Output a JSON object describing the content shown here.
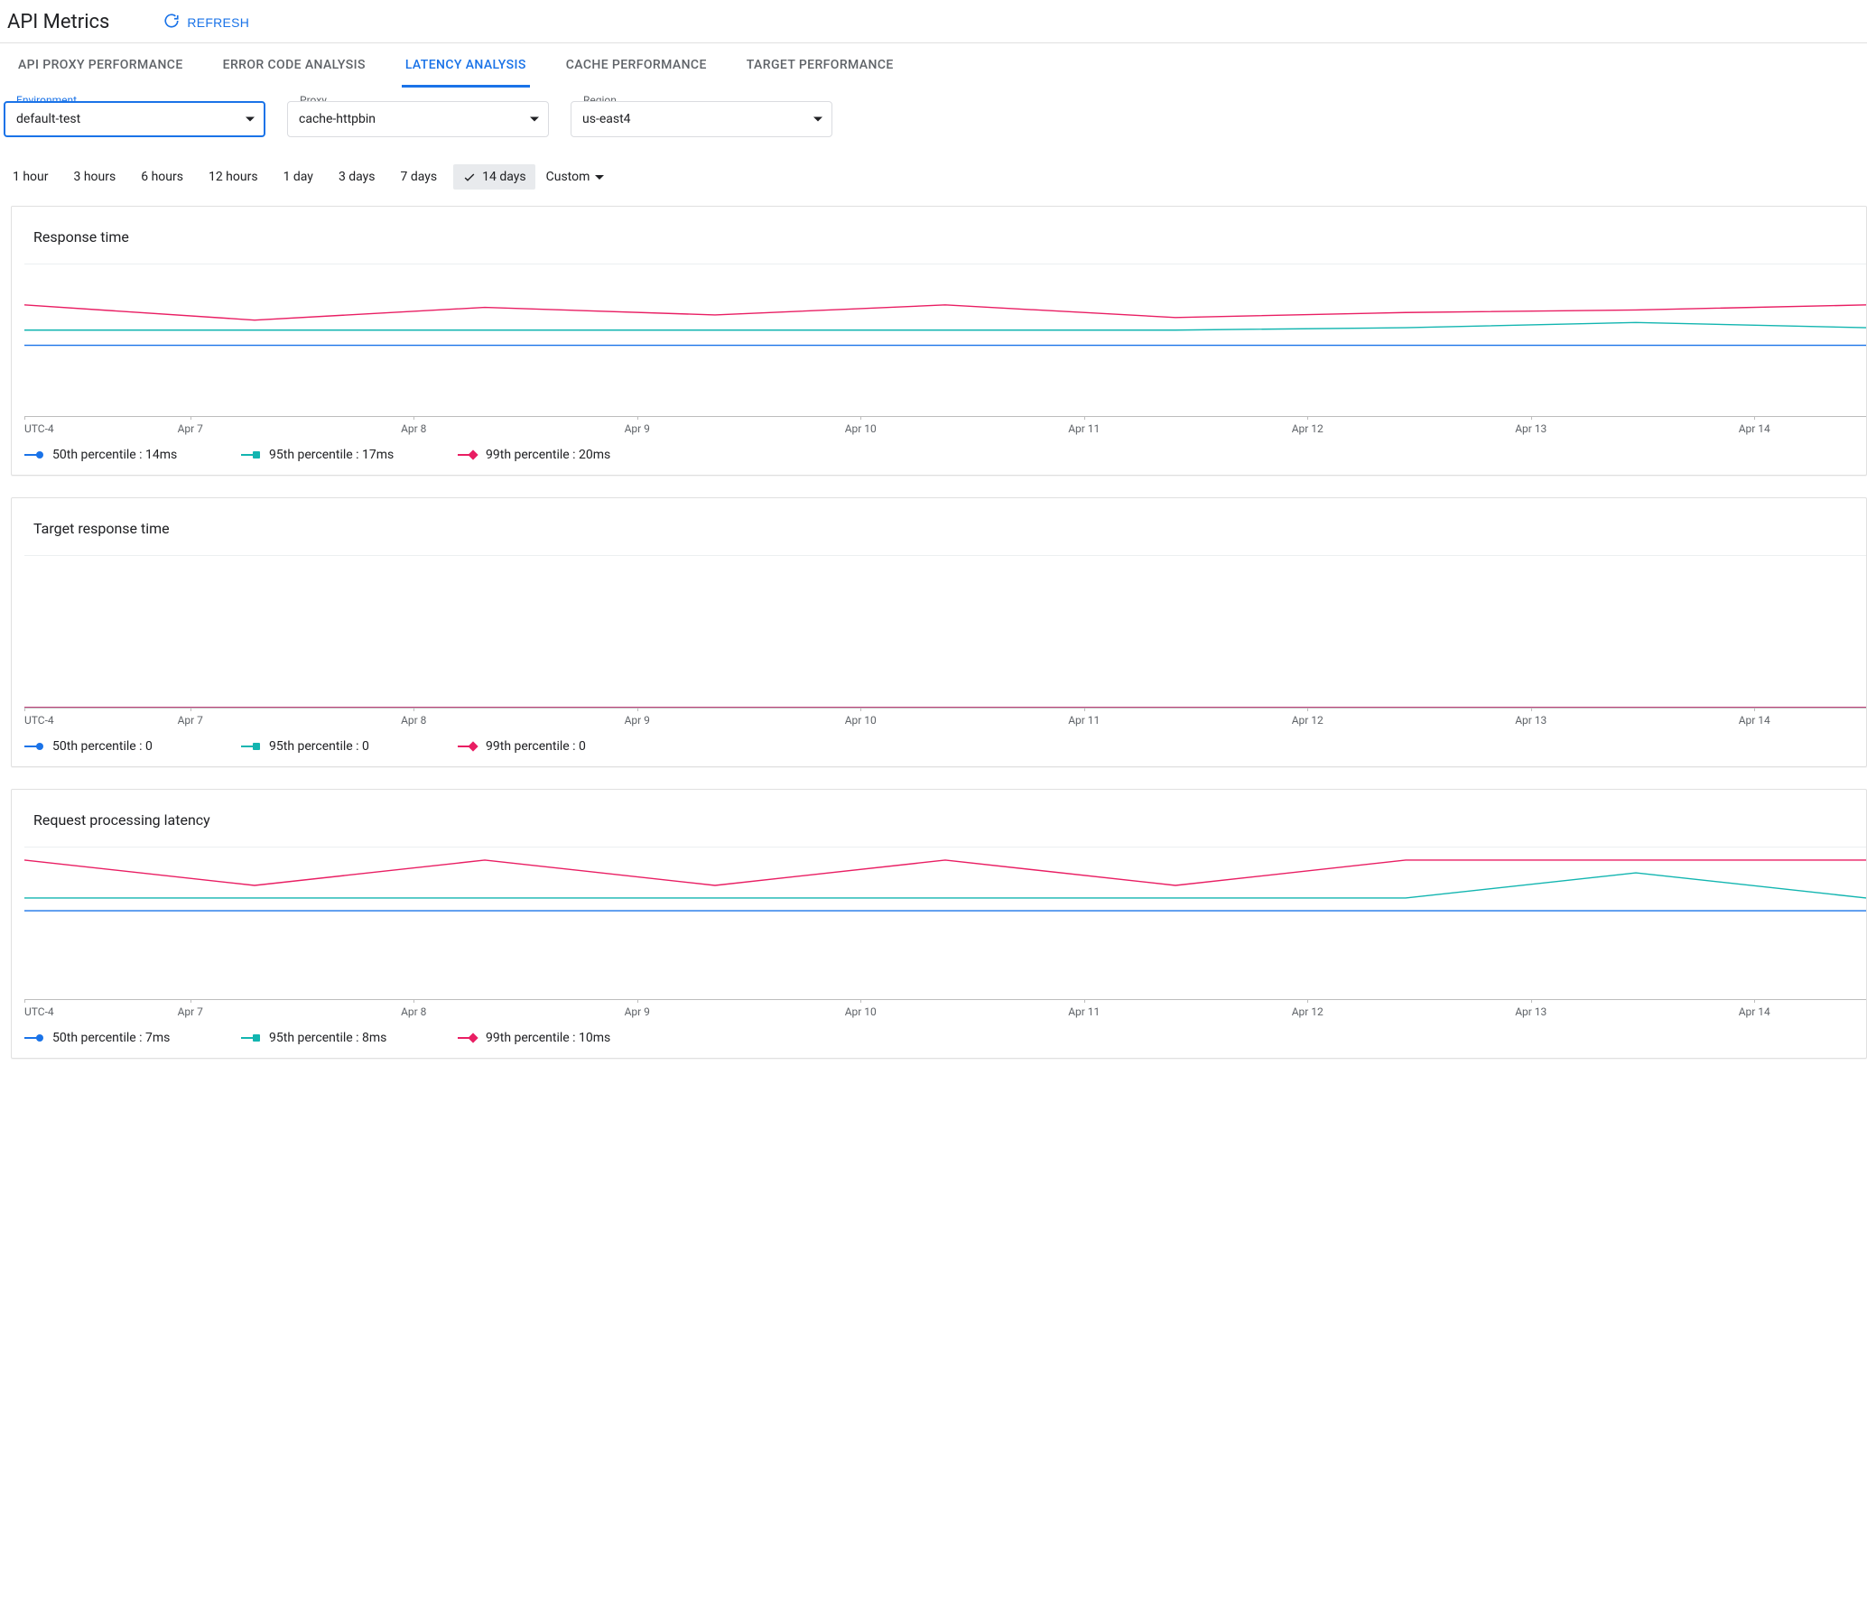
{
  "header": {
    "title": "API Metrics",
    "refresh_label": "REFRESH"
  },
  "tabs": [
    {
      "id": "proxy-perf",
      "label": "API PROXY PERFORMANCE",
      "active": false
    },
    {
      "id": "error-code",
      "label": "ERROR CODE ANALYSIS",
      "active": false
    },
    {
      "id": "latency",
      "label": "LATENCY ANALYSIS",
      "active": true
    },
    {
      "id": "cache",
      "label": "CACHE PERFORMANCE",
      "active": false
    },
    {
      "id": "target",
      "label": "TARGET PERFORMANCE",
      "active": false
    }
  ],
  "selectors": {
    "environment": {
      "label": "Environment",
      "value": "default-test"
    },
    "proxy": {
      "label": "Proxy",
      "value": "cache-httpbin"
    },
    "region": {
      "label": "Region",
      "value": "us-east4"
    }
  },
  "time_range": {
    "options": [
      "1 hour",
      "3 hours",
      "6 hours",
      "12 hours",
      "1 day",
      "3 days",
      "7 days",
      "14 days"
    ],
    "selected": "14 days",
    "custom_label": "Custom"
  },
  "colors": {
    "p50": "#1a73e8",
    "p95": "#12b5b0",
    "p99": "#e91e63"
  },
  "chart_data": [
    {
      "title": "Response time",
      "type": "line",
      "x_tz_label": "UTC-4",
      "categories": [
        "Apr 7",
        "Apr 8",
        "Apr 9",
        "Apr 10",
        "Apr 11",
        "Apr 12",
        "Apr 13",
        "Apr 14"
      ],
      "ylim": [
        0,
        30
      ],
      "series": [
        {
          "name": "50th percentile",
          "legend_value": "14ms",
          "color": "#1a73e8",
          "marker": "circle",
          "values": [
            14,
            14,
            14,
            14,
            14,
            14,
            14,
            14,
            14
          ]
        },
        {
          "name": "95th percentile",
          "legend_value": "17ms",
          "color": "#12b5b0",
          "marker": "square",
          "values": [
            17,
            17,
            17,
            17,
            17,
            17,
            17.5,
            18.5,
            17.5
          ]
        },
        {
          "name": "99th percentile",
          "legend_value": "20ms",
          "color": "#e91e63",
          "marker": "diamond",
          "values": [
            22,
            19,
            21.5,
            20,
            22,
            19.5,
            20.5,
            21,
            22
          ]
        }
      ]
    },
    {
      "title": "Target response time",
      "type": "line",
      "x_tz_label": "UTC-4",
      "categories": [
        "Apr 7",
        "Apr 8",
        "Apr 9",
        "Apr 10",
        "Apr 11",
        "Apr 12",
        "Apr 13",
        "Apr 14"
      ],
      "ylim": [
        0,
        30
      ],
      "series": [
        {
          "name": "50th percentile",
          "legend_value": "0",
          "color": "#1a73e8",
          "marker": "circle",
          "values": [
            0,
            0,
            0,
            0,
            0,
            0,
            0,
            0,
            0
          ]
        },
        {
          "name": "95th percentile",
          "legend_value": "0",
          "color": "#12b5b0",
          "marker": "square",
          "values": [
            0,
            0,
            0,
            0,
            0,
            0,
            0,
            0,
            0
          ]
        },
        {
          "name": "99th percentile",
          "legend_value": "0",
          "color": "#e91e63",
          "marker": "diamond",
          "values": [
            0,
            0,
            0,
            0,
            0,
            0,
            0,
            0,
            0
          ]
        }
      ]
    },
    {
      "title": "Request processing latency",
      "type": "line",
      "x_tz_label": "UTC-4",
      "categories": [
        "Apr 7",
        "Apr 8",
        "Apr 9",
        "Apr 10",
        "Apr 11",
        "Apr 12",
        "Apr 13",
        "Apr 14"
      ],
      "ylim": [
        0,
        12
      ],
      "series": [
        {
          "name": "50th percentile",
          "legend_value": "7ms",
          "color": "#1a73e8",
          "marker": "circle",
          "values": [
            7,
            7,
            7,
            7,
            7,
            7,
            7,
            7,
            7
          ]
        },
        {
          "name": "95th percentile",
          "legend_value": "8ms",
          "color": "#12b5b0",
          "marker": "square",
          "values": [
            8,
            8,
            8,
            8,
            8,
            8,
            8,
            10,
            8
          ]
        },
        {
          "name": "99th percentile",
          "legend_value": "10ms",
          "color": "#e91e63",
          "marker": "diamond",
          "values": [
            11,
            9,
            11,
            9,
            11,
            9,
            11,
            11,
            11
          ]
        }
      ]
    }
  ]
}
